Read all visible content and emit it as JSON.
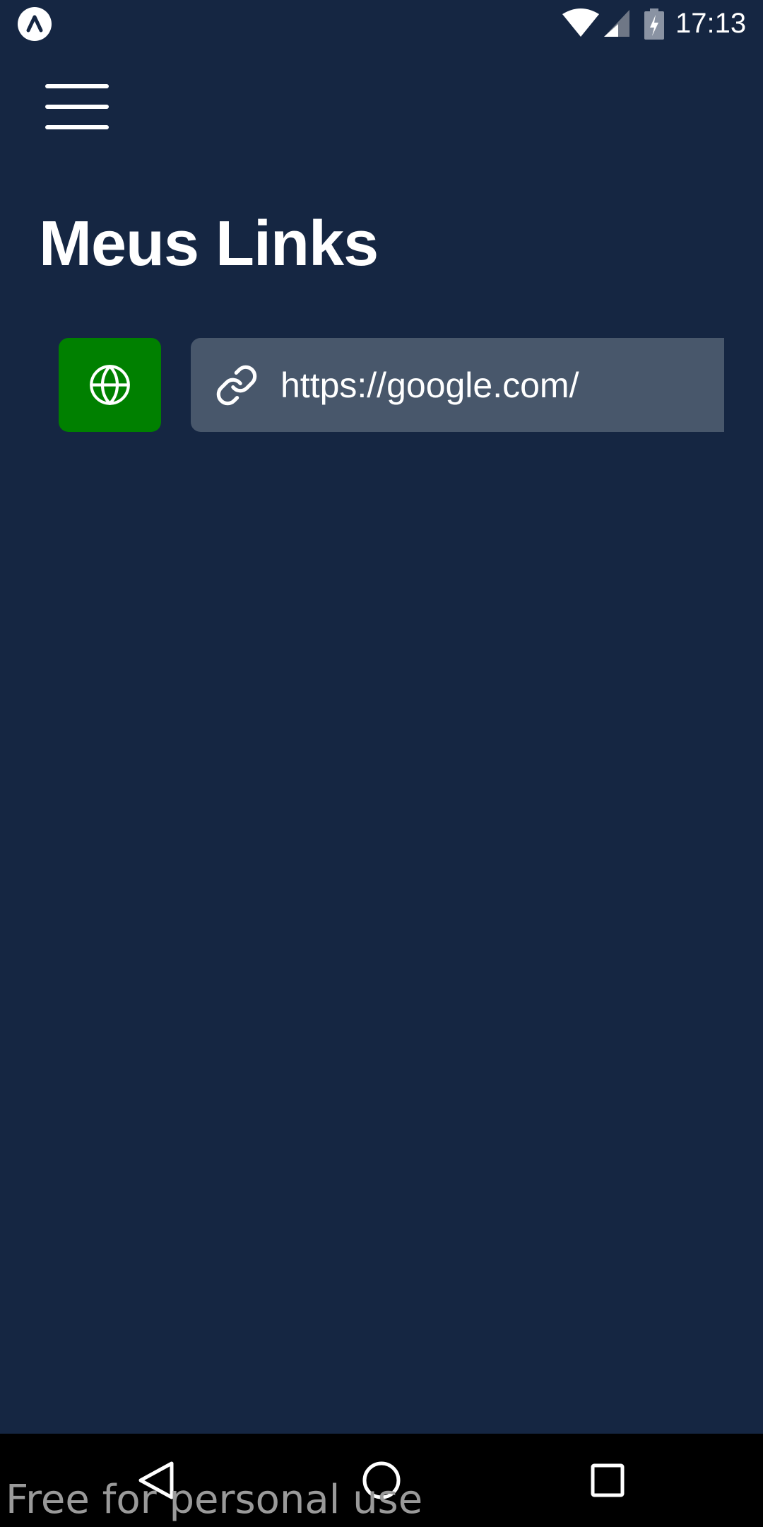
{
  "status_bar": {
    "time": "17:13",
    "icons": [
      "app-notification-icon",
      "wifi-icon",
      "signal-icon",
      "battery-charging-icon"
    ]
  },
  "header": {
    "menu_icon": "hamburger-menu-icon"
  },
  "page": {
    "title": "Meus Links"
  },
  "links": [
    {
      "site_icon": "globe-icon",
      "link_icon": "link-icon",
      "url": "https://google.com/"
    }
  ],
  "navigation_bar": {
    "icons": [
      "back-icon",
      "home-icon",
      "recents-icon"
    ]
  },
  "watermark": {
    "text": "Free for personal use"
  },
  "colors": {
    "background": "#152642",
    "site_button": "#008000",
    "link_field": "#48576b",
    "nav_bar": "#000000",
    "text": "#ffffff"
  }
}
